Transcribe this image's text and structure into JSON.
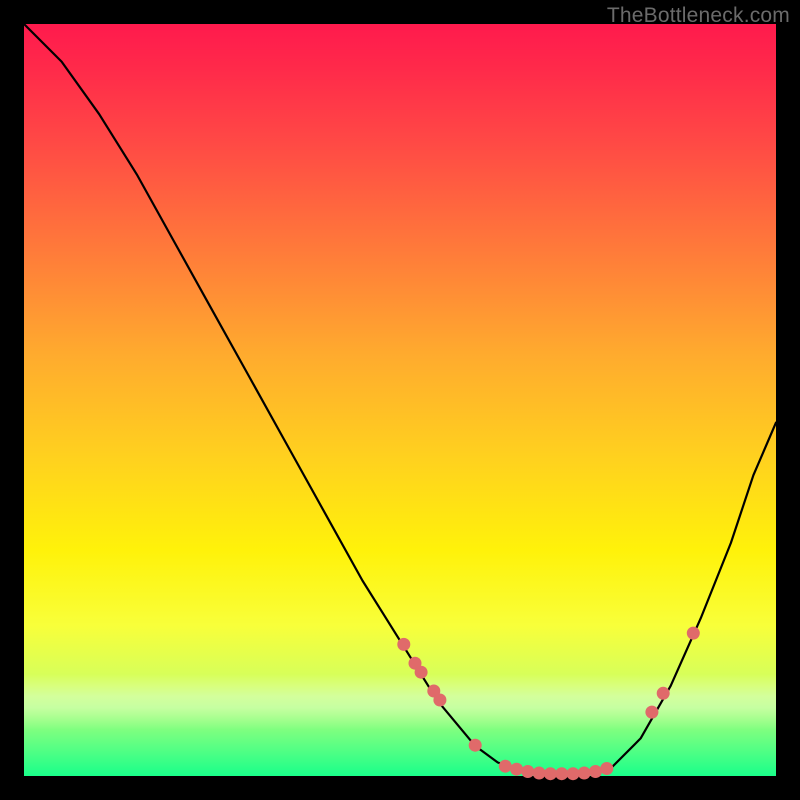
{
  "watermark": "TheBottleneck.com",
  "chart_data": {
    "type": "line",
    "title": "",
    "xlabel": "",
    "ylabel": "",
    "xlim": [
      0,
      1
    ],
    "ylim": [
      0,
      1
    ],
    "series": [
      {
        "name": "curve",
        "x": [
          0.0,
          0.05,
          0.1,
          0.15,
          0.2,
          0.25,
          0.3,
          0.35,
          0.4,
          0.45,
          0.5,
          0.55,
          0.6,
          0.63,
          0.66,
          0.7,
          0.74,
          0.78,
          0.82,
          0.86,
          0.9,
          0.94,
          0.97,
          1.0
        ],
        "y": [
          1.0,
          0.95,
          0.88,
          0.8,
          0.71,
          0.62,
          0.53,
          0.44,
          0.35,
          0.26,
          0.18,
          0.1,
          0.04,
          0.018,
          0.008,
          0.003,
          0.003,
          0.01,
          0.05,
          0.12,
          0.21,
          0.31,
          0.4,
          0.47
        ]
      }
    ],
    "markers": [
      {
        "x": 0.505,
        "y": 0.175
      },
      {
        "x": 0.52,
        "y": 0.15
      },
      {
        "x": 0.528,
        "y": 0.138
      },
      {
        "x": 0.545,
        "y": 0.113
      },
      {
        "x": 0.553,
        "y": 0.101
      },
      {
        "x": 0.6,
        "y": 0.041
      },
      {
        "x": 0.64,
        "y": 0.013
      },
      {
        "x": 0.655,
        "y": 0.009
      },
      {
        "x": 0.67,
        "y": 0.006
      },
      {
        "x": 0.685,
        "y": 0.004
      },
      {
        "x": 0.7,
        "y": 0.003
      },
      {
        "x": 0.715,
        "y": 0.003
      },
      {
        "x": 0.73,
        "y": 0.003
      },
      {
        "x": 0.745,
        "y": 0.004
      },
      {
        "x": 0.76,
        "y": 0.006
      },
      {
        "x": 0.775,
        "y": 0.01
      },
      {
        "x": 0.835,
        "y": 0.085
      },
      {
        "x": 0.85,
        "y": 0.11
      },
      {
        "x": 0.89,
        "y": 0.19
      }
    ],
    "marker_color": "#e06a6a",
    "curve_color": "#000000"
  }
}
